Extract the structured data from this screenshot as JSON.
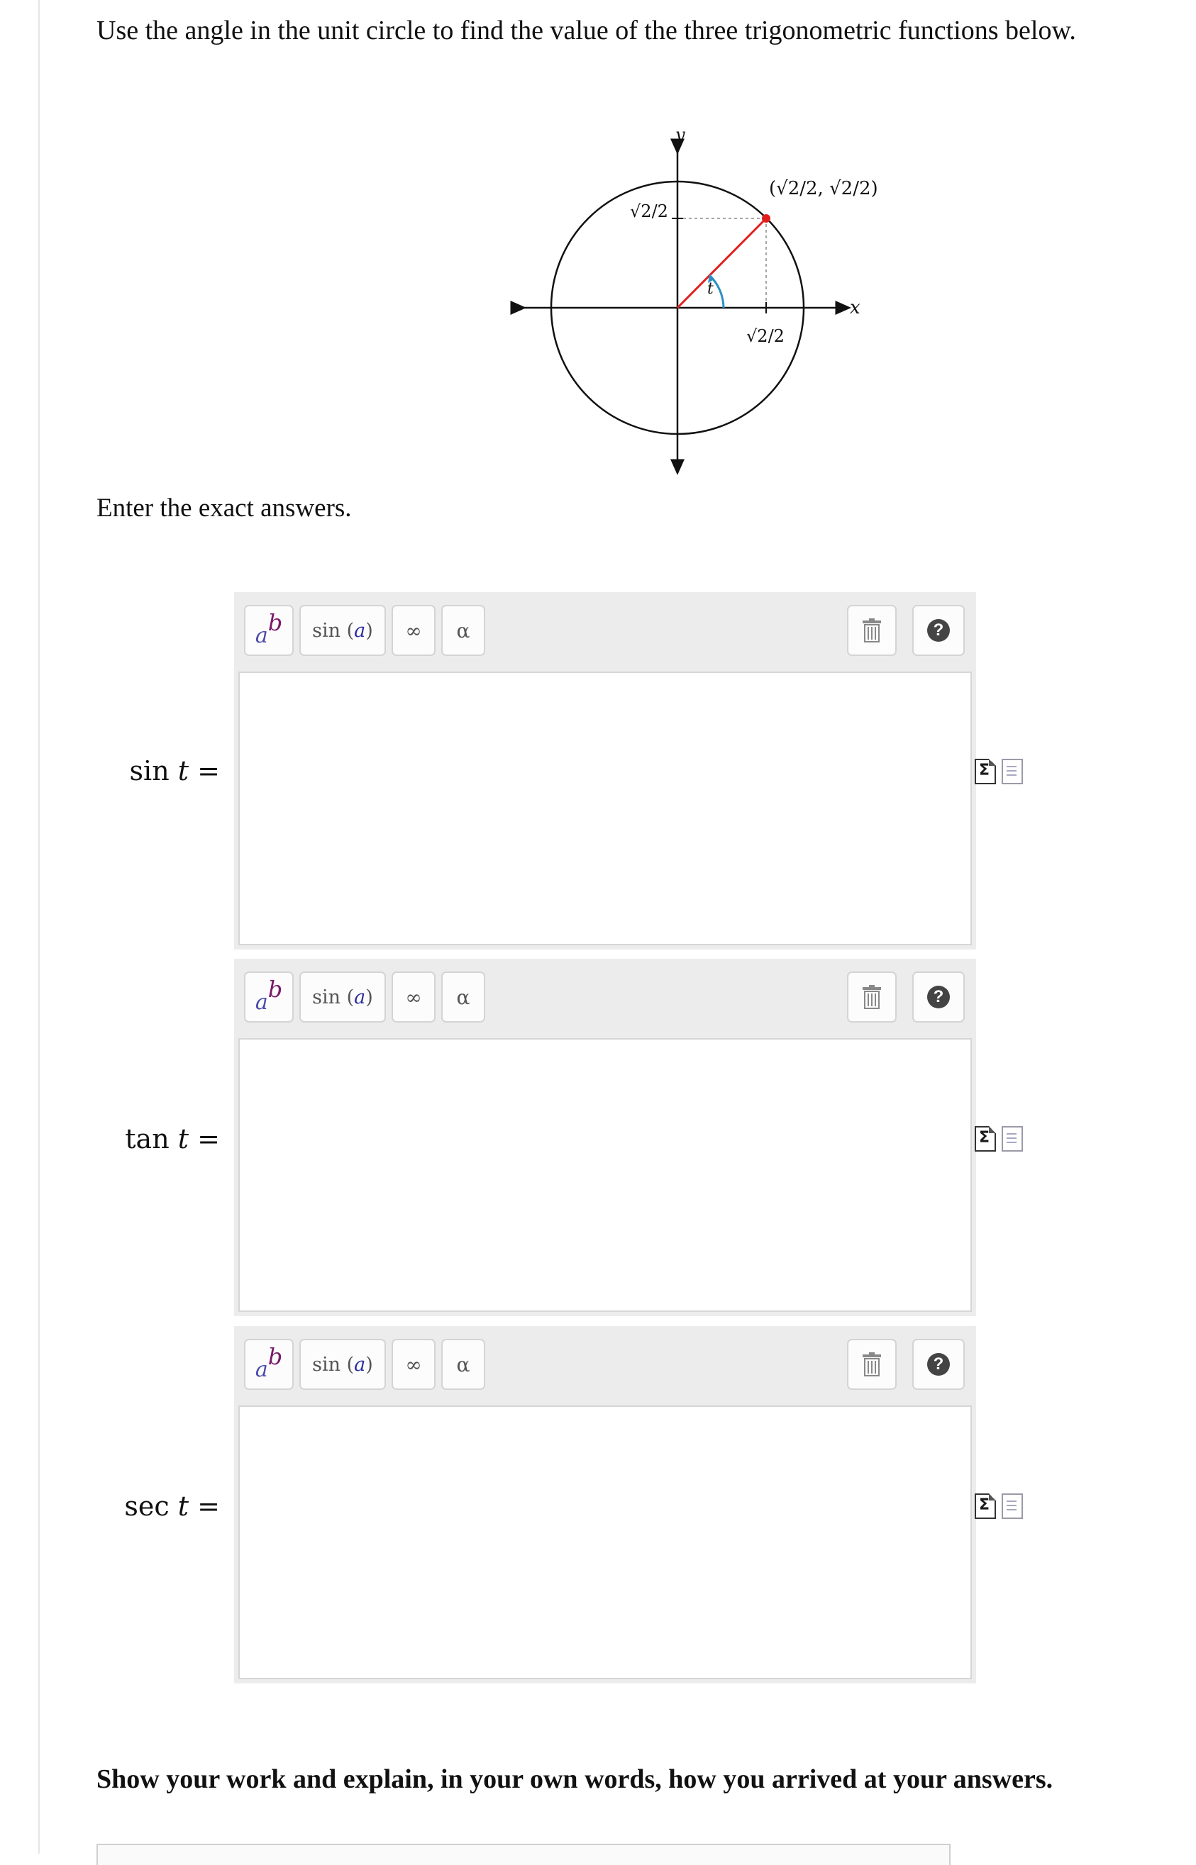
{
  "question": {
    "prompt": "Use the angle in the unit circle to find the value of the three trigonometric functions below."
  },
  "figure": {
    "y_axis_label": "y",
    "x_axis_label": "x",
    "angle_label": "t",
    "point_label": "(√2/2, √2/2)",
    "x_coordinate_label": "√2/2",
    "y_coordinate_label": "√2/2",
    "radius_color": "#e0201e",
    "point_color": "#e0201e",
    "angle_arc_color": "#2b8fc4"
  },
  "instructions": "Enter the exact answers.",
  "editor_toolbar": {
    "power_base": "a",
    "power_exp": "b",
    "function_label": "sin",
    "function_arg": "a",
    "infinity_symbol": "∞",
    "alpha_symbol": "α",
    "trash_icon": "trash-icon",
    "help_label": "?"
  },
  "answers": [
    {
      "function": "sin",
      "variable": "t",
      "equals": "=",
      "value": ""
    },
    {
      "function": "tan",
      "variable": "t",
      "equals": "=",
      "value": ""
    },
    {
      "function": "sec",
      "variable": "t",
      "equals": "=",
      "value": ""
    }
  ],
  "work_prompt": "Show your work and explain, in your own words, how you arrived at your answers.",
  "colors": {
    "editor_background": "#ececec",
    "button_border": "#d4d4d4",
    "power_exponent": "#7a1a6a",
    "function_argument": "#2a2aa0"
  }
}
